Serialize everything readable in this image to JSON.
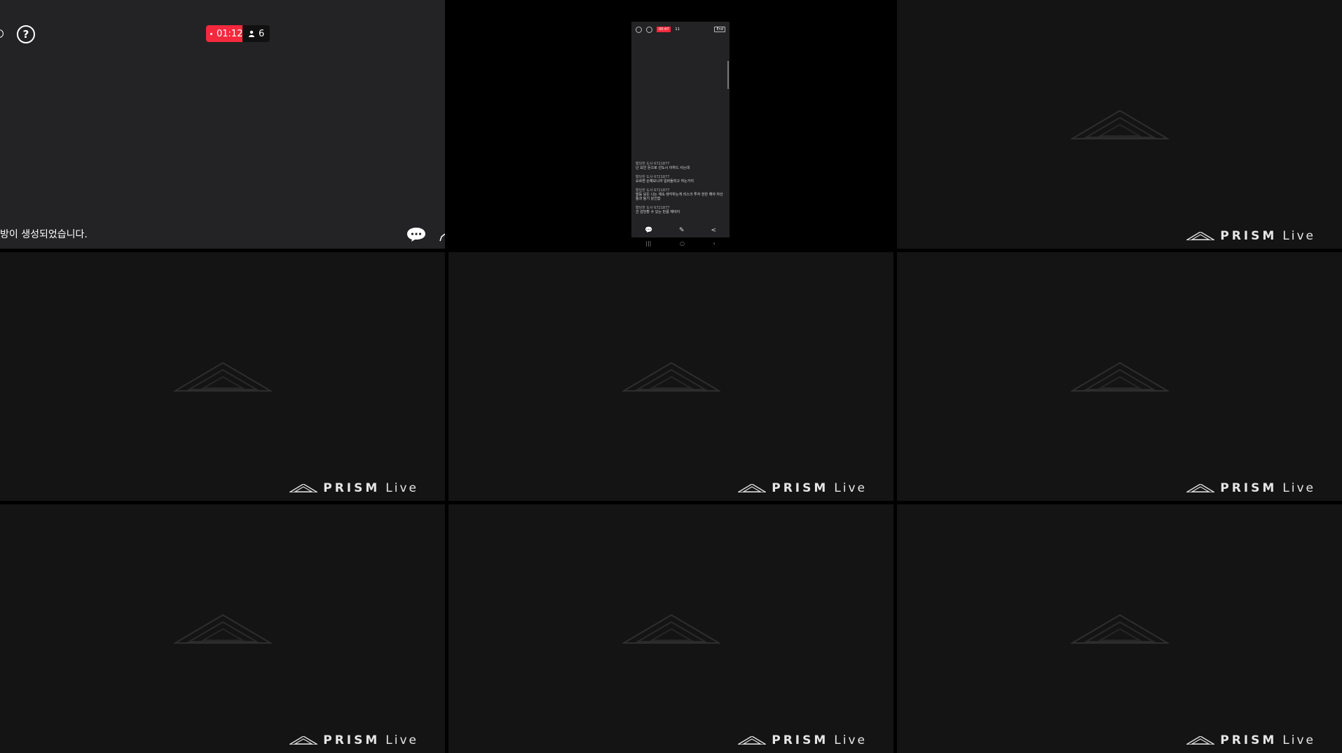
{
  "main": {
    "help_icon": "?",
    "timer": "01:12",
    "viewers": "6",
    "notice": "방이 생성되었습니다."
  },
  "phone": {
    "timer": "00:47",
    "viewers": "11",
    "end_label": "End",
    "messages": [
      {
        "name": "황당한 도사 6721877",
        "text": "난 요인 돈으로 선도시 이하드 사는데"
      },
      {
        "name": "황당한 도사 6721877",
        "text": "요르면 손해보니까 일퍼들려고 하는거지"
      },
      {
        "name": "황당한 도사 6721877",
        "text": "발등 모든 나는 계속 생각하는게 리스크 투자 전반 해야 자산 들과 들기 같긴함"
      },
      {
        "name": "황당한 도사 6721877",
        "text": "건 감당할 수 있는 만큼 해야지"
      }
    ]
  },
  "brand": {
    "part1": "PRISM",
    "part2": "Live"
  },
  "colors": {
    "live_red": "#f5293d",
    "placeholder_bg": "#141414",
    "main_bg": "#232325"
  }
}
